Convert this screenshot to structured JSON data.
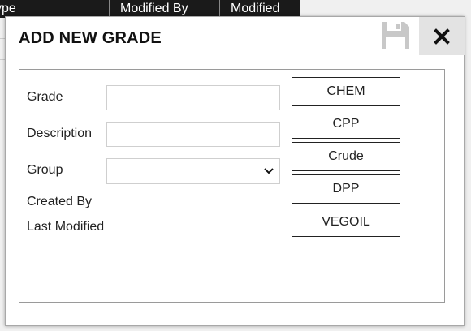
{
  "background_grid": {
    "columns": [
      "ype",
      "Modified By",
      "Modified"
    ]
  },
  "dialog": {
    "title": "ADD NEW GRADE",
    "save_icon": "floppy-disk-icon",
    "close_icon": "close-x-icon",
    "form": {
      "grade_label": "Grade",
      "grade_value": "",
      "description_label": "Description",
      "description_value": "",
      "group_label": "Group",
      "group_value": "",
      "created_by_label": "Created By",
      "last_modified_label": "Last Modified"
    },
    "groups": [
      "CHEM",
      "CPP",
      "Crude",
      "DPP",
      "VEGOIL"
    ]
  },
  "colors": {
    "header_bg": "#1a1a1a",
    "close_bg": "#e3e3e3",
    "save_icon_color": "#c8c8c8"
  }
}
